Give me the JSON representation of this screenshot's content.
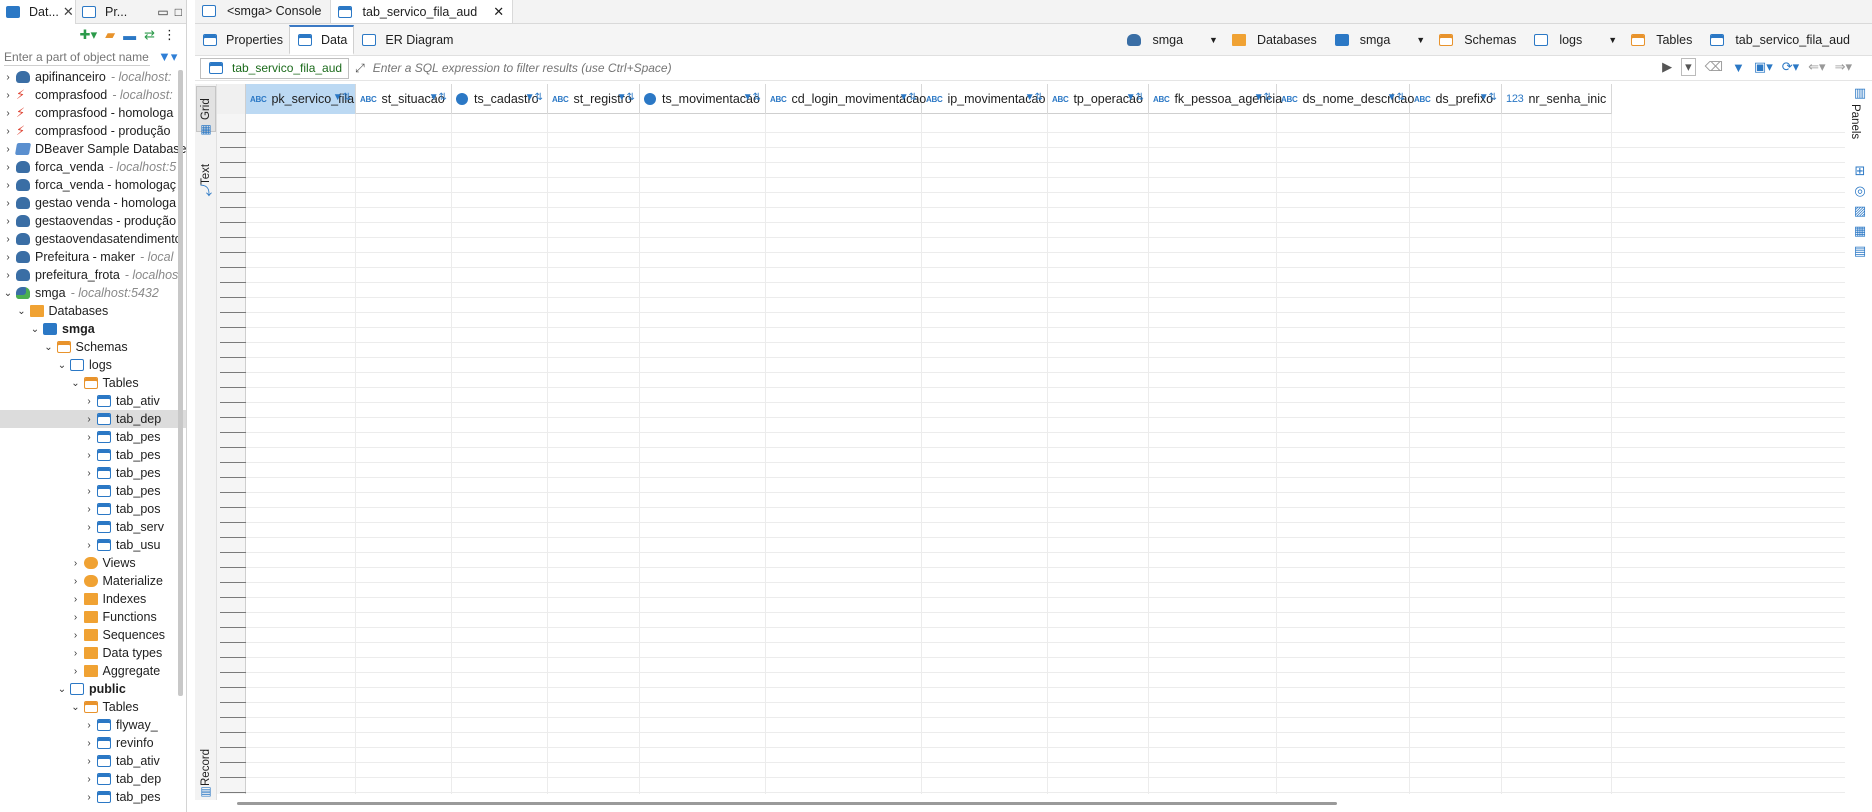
{
  "left_panel": {
    "tabs": [
      {
        "label": "Dat...",
        "close": "✕"
      },
      {
        "label": "Pr..."
      }
    ],
    "filter_placeholder": "Enter a part of object name",
    "tree": [
      {
        "label": "apifinanceiro",
        "host": "- localhost:",
        "icon": "postgres-icon",
        "level": 0,
        "arrow": "›"
      },
      {
        "label": "comprasfood",
        "host": "- localhost:",
        "icon": "error-connection-icon",
        "level": 0,
        "arrow": "›"
      },
      {
        "label": "comprasfood - homologa",
        "host": "",
        "icon": "error-connection-icon",
        "level": 0,
        "arrow": "›"
      },
      {
        "label": "comprasfood - produção",
        "host": "",
        "icon": "error-connection-icon",
        "level": 0,
        "arrow": "›"
      },
      {
        "label": "DBeaver Sample Database",
        "host": "",
        "icon": "dbeaver-icon",
        "level": 0,
        "arrow": "›"
      },
      {
        "label": "forca_venda",
        "host": "- localhost:5",
        "icon": "postgres-icon",
        "level": 0,
        "arrow": "›"
      },
      {
        "label": "forca_venda - homologaç",
        "host": "",
        "icon": "postgres-icon",
        "level": 0,
        "arrow": "›"
      },
      {
        "label": "gestao venda - homologa",
        "host": "",
        "icon": "postgres-icon",
        "level": 0,
        "arrow": "›"
      },
      {
        "label": "gestaovendas - produção",
        "host": "",
        "icon": "postgres-icon",
        "level": 0,
        "arrow": "›"
      },
      {
        "label": "gestaovendasatendimento",
        "host": "",
        "icon": "postgres-icon",
        "level": 0,
        "arrow": "›"
      },
      {
        "label": "Prefeitura - maker",
        "host": "- local",
        "icon": "postgres-icon",
        "level": 0,
        "arrow": "›"
      },
      {
        "label": "prefeitura_frota",
        "host": "- localhos",
        "icon": "postgres-icon",
        "level": 0,
        "arrow": "›"
      },
      {
        "label": "smga",
        "host": "- localhost:5432",
        "icon": "postgres-connected-icon",
        "level": 0,
        "arrow": "⌄"
      },
      {
        "label": "Databases",
        "host": "",
        "icon": "folder-icon",
        "level": 1,
        "arrow": "⌄"
      },
      {
        "label": "smga",
        "host": "",
        "icon": "database-icon",
        "level": 2,
        "arrow": "⌄",
        "bold": true
      },
      {
        "label": "Schemas",
        "host": "",
        "icon": "schemas-folder-icon",
        "level": 3,
        "arrow": "⌄"
      },
      {
        "label": "logs",
        "host": "",
        "icon": "schema-icon",
        "level": 4,
        "arrow": "⌄"
      },
      {
        "label": "Tables",
        "host": "",
        "icon": "tables-folder-icon",
        "level": 5,
        "arrow": "⌄"
      },
      {
        "label": "tab_ativ",
        "host": "",
        "icon": "table-icon",
        "level": 6,
        "arrow": "›"
      },
      {
        "label": "tab_dep",
        "host": "",
        "icon": "table-icon",
        "level": 6,
        "arrow": "›",
        "selected": true
      },
      {
        "label": "tab_pes",
        "host": "",
        "icon": "table-icon",
        "level": 6,
        "arrow": "›"
      },
      {
        "label": "tab_pes",
        "host": "",
        "icon": "table-icon",
        "level": 6,
        "arrow": "›"
      },
      {
        "label": "tab_pes",
        "host": "",
        "icon": "table-icon",
        "level": 6,
        "arrow": "›"
      },
      {
        "label": "tab_pes",
        "host": "",
        "icon": "table-icon",
        "level": 6,
        "arrow": "›"
      },
      {
        "label": "tab_pos",
        "host": "",
        "icon": "table-icon",
        "level": 6,
        "arrow": "›"
      },
      {
        "label": "tab_serv",
        "host": "",
        "icon": "table-icon",
        "level": 6,
        "arrow": "›"
      },
      {
        "label": "tab_usu",
        "host": "",
        "icon": "table-icon",
        "level": 6,
        "arrow": "›"
      },
      {
        "label": "Views",
        "host": "",
        "icon": "views-icon",
        "level": 5,
        "arrow": "›"
      },
      {
        "label": "Materialize",
        "host": "",
        "icon": "materialized-views-icon",
        "level": 5,
        "arrow": "›"
      },
      {
        "label": "Indexes",
        "host": "",
        "icon": "folder-icon",
        "level": 5,
        "arrow": "›"
      },
      {
        "label": "Functions",
        "host": "",
        "icon": "folder-icon",
        "level": 5,
        "arrow": "›"
      },
      {
        "label": "Sequences",
        "host": "",
        "icon": "folder-icon",
        "level": 5,
        "arrow": "›"
      },
      {
        "label": "Data types",
        "host": "",
        "icon": "folder-icon",
        "level": 5,
        "arrow": "›"
      },
      {
        "label": "Aggregate",
        "host": "",
        "icon": "folder-icon",
        "level": 5,
        "arrow": "›"
      },
      {
        "label": "public",
        "host": "",
        "icon": "schema-icon",
        "level": 4,
        "arrow": "⌄",
        "bold": true
      },
      {
        "label": "Tables",
        "host": "",
        "icon": "tables-folder-icon",
        "level": 5,
        "arrow": "⌄"
      },
      {
        "label": "flyway_",
        "host": "",
        "icon": "table-icon",
        "level": 6,
        "arrow": "›"
      },
      {
        "label": "revinfo",
        "host": "",
        "icon": "table-icon",
        "level": 6,
        "arrow": "›"
      },
      {
        "label": "tab_ativ",
        "host": "",
        "icon": "table-icon",
        "level": 6,
        "arrow": "›"
      },
      {
        "label": "tab_dep",
        "host": "",
        "icon": "table-icon",
        "level": 6,
        "arrow": "›"
      },
      {
        "label": "tab_pes",
        "host": "",
        "icon": "table-icon",
        "level": 6,
        "arrow": "›"
      }
    ]
  },
  "editor": {
    "tabs": [
      {
        "label": "<smga> Console",
        "icon": "console-icon"
      },
      {
        "label": "tab_servico_fila_aud",
        "icon": "table-icon",
        "active": true,
        "close": "✕"
      }
    ],
    "subtabs": [
      {
        "label": "Properties",
        "icon": "properties-icon"
      },
      {
        "label": "Data",
        "icon": "data-icon",
        "active": true
      },
      {
        "label": "ER Diagram",
        "icon": "er-diagram-icon"
      }
    ],
    "breadcrumb": [
      {
        "label": "smga",
        "icon": "postgres-icon"
      },
      {
        "label": "Databases",
        "icon": "folder-icon",
        "caret": true
      },
      {
        "label": "smga",
        "icon": "database-icon"
      },
      {
        "label": "Schemas",
        "icon": "schemas-folder-icon",
        "caret": true
      },
      {
        "label": "logs",
        "icon": "schema-icon"
      },
      {
        "label": "Tables",
        "icon": "tables-folder-icon",
        "caret": true
      },
      {
        "label": "tab_servico_fila_aud",
        "icon": "table-icon"
      }
    ],
    "filter": {
      "table_tag": "tab_servico_fila_aud",
      "placeholder": "Enter a SQL expression to filter results (use Ctrl+Space)"
    },
    "side_tabs": {
      "grid": "Grid",
      "text": "Text",
      "record": "Record"
    },
    "right_panel_label": "Panels",
    "columns": [
      {
        "name": "pk_servico_fila",
        "type": "ABC",
        "selected": true
      },
      {
        "name": "st_situacao",
        "type": "ABC"
      },
      {
        "name": "ts_cadastro",
        "type": "ts"
      },
      {
        "name": "st_registro",
        "type": "ABC"
      },
      {
        "name": "ts_movimentacao",
        "type": "ts"
      },
      {
        "name": "cd_login_movimentacao",
        "type": "ABC"
      },
      {
        "name": "ip_movimentacao",
        "type": "ABC"
      },
      {
        "name": "tp_operacao",
        "type": "ABC"
      },
      {
        "name": "fk_pessoa_agencia",
        "type": "ABC"
      },
      {
        "name": "ds_nome_descricao",
        "type": "ABC"
      },
      {
        "name": "ds_prefixo",
        "type": "ABC"
      },
      {
        "name": "nr_senha_inic",
        "type": "123"
      }
    ]
  },
  "colors": {
    "accent": "#2b78c5",
    "selected_header": "#bcd9f3",
    "tree_selection": "#dcdcdc",
    "error": "#e04a3a"
  }
}
